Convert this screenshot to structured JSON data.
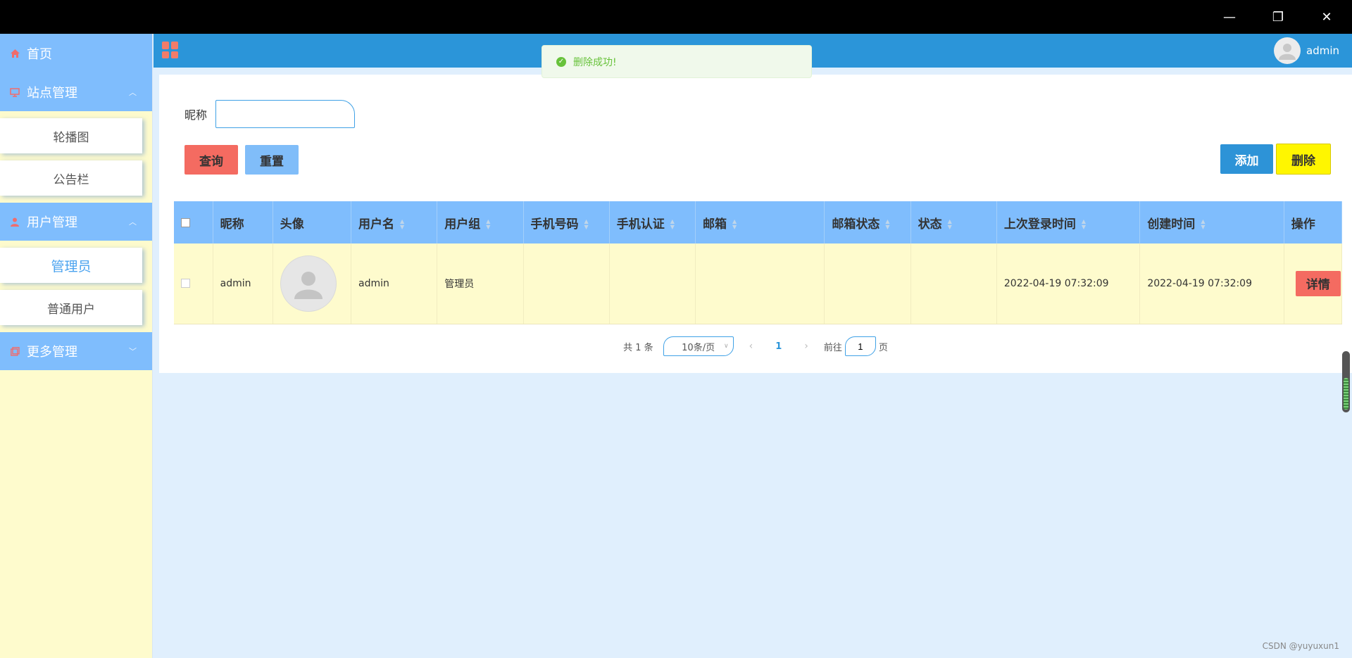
{
  "window": {
    "min_glyph": "—",
    "max_glyph": "❐",
    "close_glyph": "✕"
  },
  "sidebar": {
    "home": "首页",
    "groups": [
      {
        "label": "站点管理",
        "icon": "monitor-icon",
        "items": [
          "轮播图",
          "公告栏"
        ]
      },
      {
        "label": "用户管理",
        "icon": "user-icon",
        "items": [
          "管理员",
          "普通用户"
        ]
      },
      {
        "label": "更多管理",
        "icon": "copy-icon",
        "items": []
      }
    ]
  },
  "header": {
    "username": "admin"
  },
  "toast": {
    "message": "删除成功!"
  },
  "search": {
    "label": "昵称",
    "value": "",
    "query_label": "查询",
    "reset_label": "重置",
    "add_label": "添加",
    "delete_label": "删除"
  },
  "table": {
    "columns": [
      "昵称",
      "头像",
      "用户名",
      "用户组",
      "手机号码",
      "手机认证",
      "邮箱",
      "邮箱状态",
      "状态",
      "上次登录时间",
      "创建时间",
      "操作"
    ],
    "rows": [
      {
        "nickname": "admin",
        "username": "admin",
        "group": "管理员",
        "phone": "",
        "phone_verified": "",
        "email": "",
        "email_status": "",
        "status": "",
        "last_login": "2022-04-19 07:32:09",
        "created": "2022-04-19 07:32:09",
        "action": "详情"
      }
    ]
  },
  "pagination": {
    "total": "共 1 条",
    "page_size": "10条/页",
    "current_page": "1",
    "goto_label": "前往",
    "goto_value": "1",
    "page_suffix": "页"
  },
  "watermark": "CSDN @yuyuxun1",
  "colors": {
    "sidebar_bg": "#fefbcd",
    "menu_bg": "#7fbdfd",
    "header_bg": "#2b95d9",
    "query_btn": "#f46b61",
    "delete_btn": "#fff600"
  }
}
